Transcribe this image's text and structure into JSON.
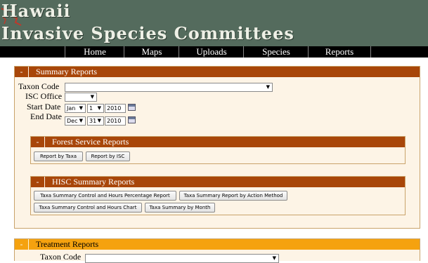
{
  "header": {
    "title_line1": "Hawaii",
    "title_line2": "Invasive Species Committees"
  },
  "nav": {
    "items": [
      "Home",
      "Maps",
      "Uploads",
      "Species",
      "Reports"
    ]
  },
  "summary_reports": {
    "toggle": "-",
    "title": "Summary Reports",
    "taxon_code_label": "Taxon Code",
    "taxon_code_value": "",
    "isc_office_label": "ISC Office",
    "isc_office_value": "",
    "start_date_label": "Start Date",
    "start_month": "Jan",
    "start_day": "1",
    "start_year": "2010",
    "end_date_label": "End Date",
    "end_month": "Dec",
    "end_day": "31",
    "end_year": "2010",
    "forest_service": {
      "toggle": "-",
      "title": "Forest Service Reports",
      "buttons": [
        "Report by Taxa",
        "Report by ISC"
      ]
    },
    "hisc_summary": {
      "toggle": "-",
      "title": "HISC Summary Reports",
      "buttons": [
        "Taxa Summary Control and Hours Percentage Report",
        "Taxa Summary Report by Action Method",
        "Taxa Summary Control and Hours Chart",
        "Taxa Summary by Month"
      ]
    }
  },
  "treatment_reports": {
    "toggle": "-",
    "title": "Treatment Reports",
    "taxon_code_label": "Taxon Code",
    "taxon_code_value": ""
  },
  "colors": {
    "header_bg": "#546b5d",
    "nav_bg": "#000000",
    "panel_head": "#a84609",
    "panel_bg": "#fdf4e6",
    "treatment_head": "#f5a20f"
  }
}
